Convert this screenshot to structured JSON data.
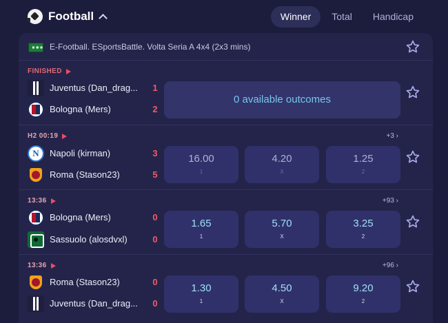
{
  "header": {
    "sport": "Football",
    "tabs": [
      {
        "label": "Winner",
        "active": true
      },
      {
        "label": "Total",
        "active": false
      },
      {
        "label": "Handicap",
        "active": false
      }
    ]
  },
  "league": {
    "name": "E-Football. ESportsBattle. Volta Seria A 4x4 (2x3 mins)",
    "flag_text": "▪◆▪"
  },
  "matches": [
    {
      "status": "FINISHED",
      "more": "",
      "home": {
        "name": "Juventus (Dan_drag...",
        "score": "1",
        "logo": "juventus-logo"
      },
      "away": {
        "name": "Bologna (Mers)",
        "score": "2",
        "logo": "bologna-logo"
      },
      "no_outcomes": "0 available outcomes"
    },
    {
      "status": "H2 00:19",
      "more": "+3 ›",
      "home": {
        "name": "Napoli (kirman)",
        "score": "3",
        "logo": "napoli-logo"
      },
      "away": {
        "name": "Roma (Stason23)",
        "score": "5",
        "logo": "roma-logo"
      },
      "odds": [
        {
          "value": "16.00",
          "label": "1"
        },
        {
          "value": "4.20",
          "label": "X"
        },
        {
          "value": "1.25",
          "label": "2"
        }
      ]
    },
    {
      "status": "13:36",
      "more": "+93 ›",
      "home": {
        "name": "Bologna (Mers)",
        "score": "0",
        "logo": "bologna-logo"
      },
      "away": {
        "name": "Sassuolo (alosdvxl)",
        "score": "0",
        "logo": "sassuolo-logo"
      },
      "odds": [
        {
          "value": "1.65",
          "label": "1"
        },
        {
          "value": "5.70",
          "label": "X"
        },
        {
          "value": "3.25",
          "label": "2"
        }
      ]
    },
    {
      "status": "13:36",
      "more": "+96 ›",
      "home": {
        "name": "Roma (Stason23)",
        "score": "0",
        "logo": "roma-logo"
      },
      "away": {
        "name": "Juventus (Dan_drag...",
        "score": "0",
        "logo": "juventus-logo"
      },
      "odds": [
        {
          "value": "1.30",
          "label": "1"
        },
        {
          "value": "4.50",
          "label": "X"
        },
        {
          "value": "9.20",
          "label": "2"
        }
      ]
    }
  ],
  "colors": {
    "background": "#1c1c3d",
    "card": "#24244a",
    "odd_button": "#30316a",
    "odd_value": "#9fe0f5",
    "score": "#ef5b68",
    "live_marker": "#ef4b61",
    "star": "#a5a9e8"
  }
}
